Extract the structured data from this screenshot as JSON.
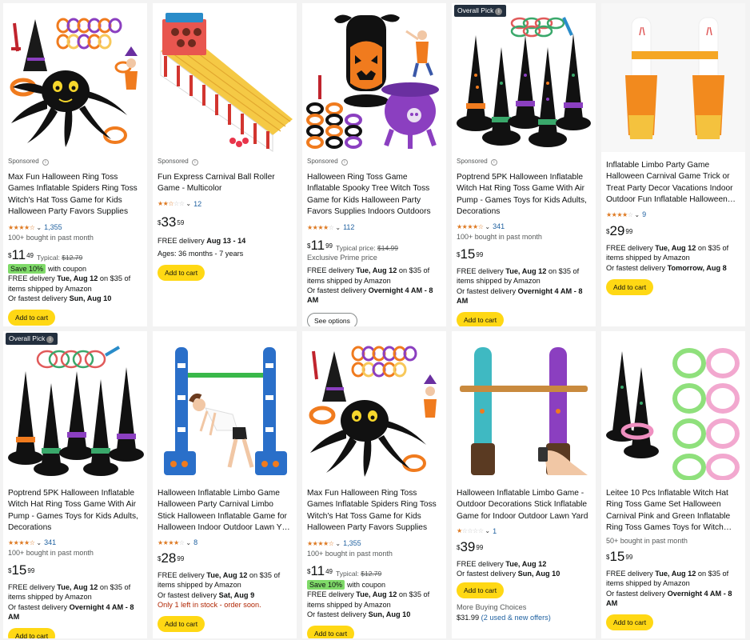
{
  "products": [
    {
      "badge": "",
      "sponsored": "Sponsored",
      "title": "Max Fun Halloween Ring Toss Games Inflatable Spiders Ring Toss Witch's Hat Toss Game for Kids Halloween Party Favors Supplies Indoors…",
      "rating": 4.5,
      "rating_count": "1,355",
      "bought": "100+ bought in past month",
      "price_dollars": "11",
      "price_cents": "49",
      "typical_label": "Typical:",
      "typical_price": "$12.79",
      "coupon_badge": "Save 10%",
      "coupon_text": "with coupon",
      "delivery_prefix": "FREE delivery",
      "delivery_date": "Tue, Aug 12",
      "delivery_suffix": "on $35 of items shipped by Amazon",
      "fastest_prefix": "Or fastest delivery",
      "fastest_date": "Sun, Aug 10",
      "button": "Add to cart"
    },
    {
      "badge": "",
      "sponsored": "Sponsored",
      "title": "Fun Express Carnival Ball Roller Game - Multicolor",
      "rating": 2.5,
      "rating_count": "12",
      "price_dollars": "33",
      "price_cents": "59",
      "delivery_prefix": "FREE delivery",
      "delivery_date": "Aug 13 - 14",
      "ages": "Ages: 36 months - 7 years",
      "button": "Add to cart"
    },
    {
      "badge": "",
      "sponsored": "Sponsored",
      "title": "Halloween Ring Toss Game Inflatable Spooky Tree Witch Toss Game for Kids Halloween Party Favors Supplies Indoors Outdoors Great Holiday…",
      "rating": 4.0,
      "rating_count": "112",
      "price_dollars": "11",
      "price_cents": "99",
      "typical_label": "Typical price:",
      "typical_price": "$14.99",
      "prime_note": "Exclusive Prime price",
      "delivery_prefix": "FREE delivery",
      "delivery_date": "Tue, Aug 12",
      "delivery_suffix": "on $35 of items shipped by Amazon",
      "fastest_prefix": "Or fastest delivery",
      "fastest_date": "Overnight 4 AM - 8 AM",
      "button": "See options"
    },
    {
      "badge": "Overall Pick",
      "sponsored": "Sponsored",
      "title": "Poptrend 5PK Halloween Inflatable Witch Hat Ring Toss Game With Air Pump - Games Toys for Kids Adults, Decorations",
      "rating": 4.5,
      "rating_count": "341",
      "bought": "100+ bought in past month",
      "price_dollars": "15",
      "price_cents": "99",
      "delivery_prefix": "FREE delivery",
      "delivery_date": "Tue, Aug 12",
      "delivery_suffix": "on $35 of items shipped by Amazon",
      "fastest_prefix": "Or fastest delivery",
      "fastest_date": "Overnight 4 AM - 8 AM",
      "button": "Add to cart"
    },
    {
      "badge": "",
      "sponsored": "",
      "title": "Inflatable Limbo Party Game Halloween Carnival Game Trick or Treat Party Decor Vacations Indoor Outdoor Fun Inflatable Halloween…",
      "rating": 4.0,
      "rating_count": "9",
      "price_dollars": "29",
      "price_cents": "99",
      "delivery_prefix": "FREE delivery",
      "delivery_date": "Tue, Aug 12",
      "delivery_suffix": "on $35 of items shipped by Amazon",
      "fastest_prefix": "Or fastest delivery",
      "fastest_date": "Tomorrow, Aug 8",
      "button": "Add to cart"
    },
    {
      "badge": "Overall Pick",
      "sponsored": "",
      "title": "Poptrend 5PK Halloween Inflatable Witch Hat Ring Toss Game With Air Pump - Games Toys for Kids Adults, Decorations",
      "rating": 4.5,
      "rating_count": "341",
      "bought": "100+ bought in past month",
      "price_dollars": "15",
      "price_cents": "99",
      "delivery_prefix": "FREE delivery",
      "delivery_date": "Tue, Aug 12",
      "delivery_suffix": "on $35 of items shipped by Amazon",
      "fastest_prefix": "Or fastest delivery",
      "fastest_date": "Overnight 4 AM - 8 AM",
      "button": "Add to cart"
    },
    {
      "badge": "",
      "sponsored": "",
      "title": "Halloween Inflatable Limbo Game Halloween Party Carnival Limbo Stick Halloween Inflatable Game for Halloween Indoor Outdoor Lawn Y…",
      "rating": 4.0,
      "rating_count": "8",
      "price_dollars": "28",
      "price_cents": "99",
      "delivery_prefix": "FREE delivery",
      "delivery_date": "Tue, Aug 12",
      "delivery_suffix": "on $35 of items shipped by Amazon",
      "fastest_prefix": "Or fastest delivery",
      "fastest_date": "Sat, Aug 9",
      "stock_note": "Only 1 left in stock - order soon.",
      "button": "Add to cart"
    },
    {
      "badge": "",
      "sponsored": "",
      "title": "Max Fun Halloween Ring Toss Games Inflatable Spiders Ring Toss Witch's Hat Toss Game for Kids Halloween Party Favors Supplies Indoors…",
      "rating": 4.5,
      "rating_count": "1,355",
      "bought": "100+ bought in past month",
      "price_dollars": "11",
      "price_cents": "49",
      "typical_label": "Typical:",
      "typical_price": "$12.79",
      "coupon_badge": "Save 10%",
      "coupon_text": "with coupon",
      "delivery_prefix": "FREE delivery",
      "delivery_date": "Tue, Aug 12",
      "delivery_suffix": "on $35 of items shipped by Amazon",
      "fastest_prefix": "Or fastest delivery",
      "fastest_date": "Sun, Aug 10",
      "button": "Add to cart"
    },
    {
      "badge": "",
      "sponsored": "",
      "title": "Halloween Inflatable Limbo Game - Outdoor Decorations Stick Inflatable Game for Indoor Outdoor Lawn Yard",
      "rating": 1.0,
      "rating_count": "1",
      "price_dollars": "39",
      "price_cents": "99",
      "delivery_prefix": "FREE delivery",
      "delivery_date": "Tue, Aug 12",
      "fastest_prefix": "Or fastest delivery",
      "fastest_date": "Sun, Aug 10",
      "button": "Add to cart",
      "more_choices": "More Buying Choices",
      "used_price": "$31.99",
      "used_link": "(2 used & new offers)"
    },
    {
      "badge": "",
      "sponsored": "",
      "title": "Leitee 10 Pcs Inflatable Witch Hat Ring Toss Game Set Halloween Carnival Pink and Green Inflatable Ring Toss Games Toys for Witch…",
      "rating": 4.5,
      "rating_count": "",
      "bought": "50+ bought in past month",
      "price_dollars": "15",
      "price_cents": "99",
      "delivery_prefix": "FREE delivery",
      "delivery_date": "Tue, Aug 12",
      "delivery_suffix": "on $35 of items shipped by Amazon",
      "fastest_prefix": "Or fastest delivery",
      "fastest_date": "Overnight 4 AM - 8 AM",
      "button": "Add to cart"
    }
  ],
  "colors": {
    "add_button": "#ffd814",
    "link": "#2162a1",
    "star": "#de7921",
    "coupon": "#7fda69",
    "stock_warning": "#b12704"
  }
}
